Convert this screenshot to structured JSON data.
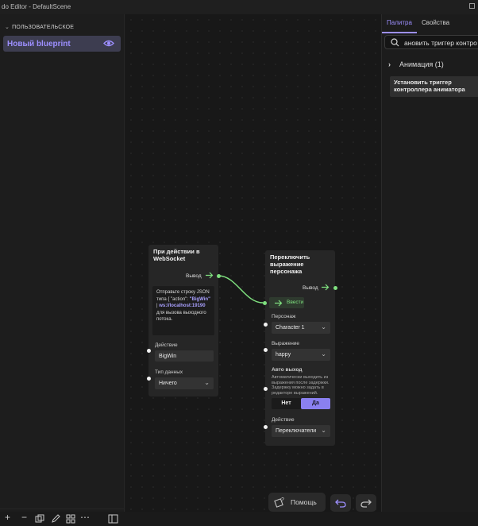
{
  "window": {
    "title": "do Editor - DefaultScene"
  },
  "sidebar": {
    "section_label": "ПОЛЬЗОВАТЕЛЬСКОЕ",
    "blueprint_label": "Новый blueprint"
  },
  "panel": {
    "tabs": [
      "Палитра",
      "Свойства"
    ],
    "active_tab": "Палитра",
    "search_value": "ановить триггер контро",
    "category": "Анимация (1)",
    "item": "Установить триггер контроллера аниматора"
  },
  "node1": {
    "title": "При действии в WebSocket",
    "output_label": "Вывод",
    "info_text_1": "Отправьте строку JSON типа { \"action\": ",
    "info_bold_1": "\"BigWin\"",
    "info_text_2": " | ",
    "info_bold_2": "ws://localhost:19190",
    "info_text_3": " для вызова выходного потока.",
    "action_label": "Действие",
    "action_value": "BigWin",
    "datatype_label": "Тип данных",
    "datatype_value": "Ничего"
  },
  "node2": {
    "title": "Переключить выражение персонажа",
    "output_label": "Вывод",
    "input_label": "Ввести",
    "character_label": "Персонаж",
    "character_value": "Character 1",
    "expression_label": "Выражение",
    "expression_value": "happy",
    "auto_label": "Авто выход",
    "auto_desc": "Автоматически выходить из выражения после задержки. Задержку можно задать в редакторе выражений.",
    "toggle_no": "Нет",
    "toggle_yes": "Да",
    "toggle_selected": "Да",
    "action_label": "Действие",
    "action_value": "Переключатели"
  },
  "footer": {
    "help_label": "Помощь"
  },
  "colors": {
    "accent": "#9d8fff",
    "exec": "#7fe07f",
    "node_bg": "#262626"
  }
}
